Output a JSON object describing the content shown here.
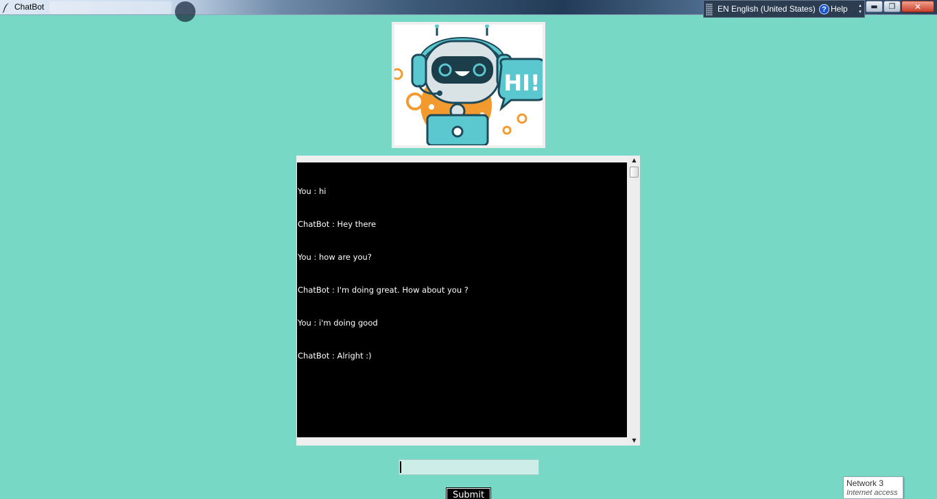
{
  "window": {
    "title": "ChatBot",
    "icon": "feather-icon",
    "minimize_glyph": "▬",
    "maximize_glyph": "❐",
    "close_glyph": "✕"
  },
  "language_bar": {
    "language": "EN English (United States)",
    "help_icon_glyph": "?",
    "help_label": "Help",
    "arrows_glyph": "▴ ▾"
  },
  "banner": {
    "icon": "robot-hi-image",
    "speech_text": "HI!"
  },
  "chat": {
    "messages": [
      "You : hi",
      "ChatBot : Hey there",
      "You : how are you?",
      "ChatBot : I'm doing great. How about you ?",
      "You : i'm doing good",
      "ChatBot : Alright :)"
    ],
    "scroll_up_glyph": "▲",
    "scroll_down_glyph": "▼"
  },
  "input": {
    "value": ""
  },
  "submit": {
    "label": "Submit"
  },
  "network_tooltip": {
    "name": "Network  3",
    "status": "Internet access"
  },
  "colors": {
    "background": "#77d8c5",
    "chat_bg": "#000000",
    "chat_text": "#ffffff",
    "input_bg": "#cdeee8",
    "robot_teal": "#5bc7cf",
    "robot_orange": "#f39a2e"
  }
}
